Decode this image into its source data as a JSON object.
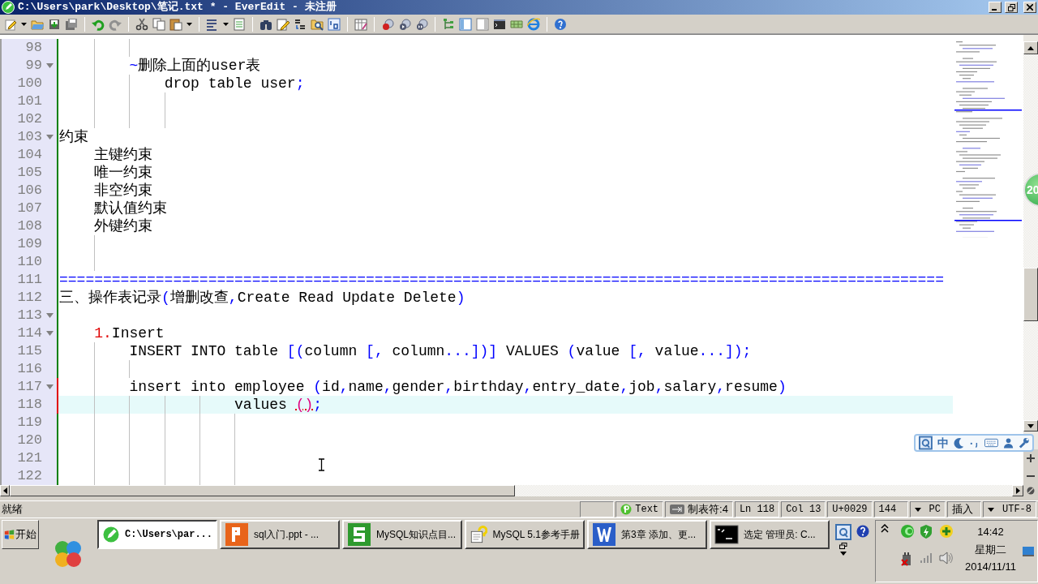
{
  "window": {
    "title": "C:\\Users\\park\\Desktop\\笔记.txt * - EverEdit - 未注册"
  },
  "editor": {
    "lines": [
      {
        "number": "98",
        "fold": false,
        "modified": false,
        "selected": false
      },
      {
        "number": "99",
        "fold": true,
        "modified": false,
        "selected": false,
        "segments": [
          {
            "kind": "symbol",
            "text": "        ~"
          },
          {
            "kind": "plain",
            "text": "删除上面的user表"
          }
        ]
      },
      {
        "number": "100",
        "fold": false,
        "modified": false,
        "selected": false,
        "segments": [
          {
            "kind": "plain",
            "text": "            drop table user"
          },
          {
            "kind": "symbol",
            "text": ";"
          }
        ]
      },
      {
        "number": "101",
        "fold": false,
        "modified": false,
        "selected": false
      },
      {
        "number": "102",
        "fold": false,
        "modified": false,
        "selected": false
      },
      {
        "number": "103",
        "fold": true,
        "modified": false,
        "selected": false,
        "segments": [
          {
            "kind": "plain",
            "text": "约束"
          }
        ]
      },
      {
        "number": "104",
        "fold": false,
        "modified": false,
        "selected": false,
        "segments": [
          {
            "kind": "plain",
            "text": "    主键约束"
          }
        ]
      },
      {
        "number": "105",
        "fold": false,
        "modified": false,
        "selected": false,
        "segments": [
          {
            "kind": "plain",
            "text": "    唯一约束"
          }
        ]
      },
      {
        "number": "106",
        "fold": false,
        "modified": false,
        "selected": false,
        "segments": [
          {
            "kind": "plain",
            "text": "    非空约束"
          }
        ]
      },
      {
        "number": "107",
        "fold": false,
        "modified": false,
        "selected": false,
        "segments": [
          {
            "kind": "plain",
            "text": "    默认值约束"
          }
        ]
      },
      {
        "number": "108",
        "fold": false,
        "modified": false,
        "selected": false,
        "segments": [
          {
            "kind": "plain",
            "text": "    外键约束"
          }
        ]
      },
      {
        "number": "109",
        "fold": false,
        "modified": false,
        "selected": false
      },
      {
        "number": "110",
        "fold": false,
        "modified": false,
        "selected": false
      },
      {
        "number": "111",
        "fold": false,
        "modified": false,
        "selected": false,
        "segments": [
          {
            "kind": "symbol",
            "text": "====================================================================================================="
          }
        ]
      },
      {
        "number": "112",
        "fold": false,
        "modified": false,
        "selected": false,
        "segments": [
          {
            "kind": "plain",
            "text": "三、操作表记录"
          },
          {
            "kind": "symbol",
            "text": "("
          },
          {
            "kind": "plain",
            "text": "增删改查"
          },
          {
            "kind": "symbol",
            "text": ","
          },
          {
            "kind": "plain",
            "text": "Create Read Update Delete"
          },
          {
            "kind": "symbol",
            "text": ")"
          }
        ]
      },
      {
        "number": "113",
        "fold": true,
        "modified": false,
        "selected": false
      },
      {
        "number": "114",
        "fold": true,
        "modified": false,
        "selected": false,
        "segments": [
          {
            "kind": "marker",
            "text": "    1."
          },
          {
            "kind": "plain",
            "text": "Insert"
          }
        ]
      },
      {
        "number": "115",
        "fold": false,
        "modified": false,
        "selected": false,
        "segments": [
          {
            "kind": "plain",
            "text": "        INSERT INTO table "
          },
          {
            "kind": "symbol",
            "text": "[("
          },
          {
            "kind": "plain",
            "text": "column "
          },
          {
            "kind": "symbol",
            "text": "[,"
          },
          {
            "kind": "plain",
            "text": " column"
          },
          {
            "kind": "symbol",
            "text": "...])]"
          },
          {
            "kind": "plain",
            "text": " VALUES "
          },
          {
            "kind": "symbol",
            "text": "("
          },
          {
            "kind": "plain",
            "text": "value "
          },
          {
            "kind": "symbol",
            "text": "[,"
          },
          {
            "kind": "plain",
            "text": " value"
          },
          {
            "kind": "symbol",
            "text": "...]);"
          }
        ]
      },
      {
        "number": "116",
        "fold": false,
        "modified": false,
        "selected": false
      },
      {
        "number": "117",
        "fold": true,
        "modified": true,
        "selected": false,
        "segments": [
          {
            "kind": "plain",
            "text": "        insert into employee "
          },
          {
            "kind": "symbol",
            "text": "("
          },
          {
            "kind": "plain",
            "text": "id"
          },
          {
            "kind": "symbol",
            "text": ","
          },
          {
            "kind": "plain",
            "text": "name"
          },
          {
            "kind": "symbol",
            "text": ","
          },
          {
            "kind": "plain",
            "text": "gender"
          },
          {
            "kind": "symbol",
            "text": ","
          },
          {
            "kind": "plain",
            "text": "birthday"
          },
          {
            "kind": "symbol",
            "text": ","
          },
          {
            "kind": "plain",
            "text": "entry_date"
          },
          {
            "kind": "symbol",
            "text": ","
          },
          {
            "kind": "plain",
            "text": "job"
          },
          {
            "kind": "symbol",
            "text": ","
          },
          {
            "kind": "plain",
            "text": "salary"
          },
          {
            "kind": "symbol",
            "text": ","
          },
          {
            "kind": "plain",
            "text": "resume"
          },
          {
            "kind": "symbol",
            "text": ")"
          }
        ]
      },
      {
        "number": "118",
        "fold": false,
        "modified": true,
        "selected": true,
        "segments": [
          {
            "kind": "plain",
            "text": "                    values "
          },
          {
            "kind": "match",
            "text": "()"
          },
          {
            "kind": "symbol",
            "text": ";"
          }
        ]
      },
      {
        "number": "119",
        "fold": false,
        "modified": false,
        "selected": false
      },
      {
        "number": "120",
        "fold": false,
        "modified": false,
        "selected": false
      },
      {
        "number": "121",
        "fold": false,
        "modified": false,
        "selected": false
      },
      {
        "number": "122",
        "fold": false,
        "modified": false,
        "selected": false
      }
    ]
  },
  "floating_badge": {
    "text": "20"
  },
  "ime_bar": {
    "mode": "中"
  },
  "status_bar": {
    "message": "就绪",
    "panels": [
      {
        "kind": "blank"
      },
      {
        "kind": "file-type",
        "text": "Text"
      },
      {
        "kind": "tab",
        "text": "制表符:4"
      },
      {
        "kind": "plain",
        "text": "Ln 118"
      },
      {
        "kind": "plain",
        "text": "Col 13"
      },
      {
        "kind": "plain",
        "text": "U+0029"
      },
      {
        "kind": "plain",
        "text": "144"
      },
      {
        "kind": "dropdown",
        "text": "PC"
      },
      {
        "kind": "plain",
        "text": "插入"
      },
      {
        "kind": "dropdown",
        "text": "UTF-8"
      }
    ]
  },
  "taskbar": {
    "start": "开始",
    "tasks": [
      {
        "kind": "editor",
        "label": "C:\\Users\\par...",
        "selected": true
      },
      {
        "kind": "slides",
        "label": "sql入门.ppt - ...",
        "selected": false
      },
      {
        "kind": "sheet",
        "label": "MySQL知识点目...",
        "selected": false
      },
      {
        "kind": "help",
        "label": "MySQL 5.1参考手册",
        "selected": false
      },
      {
        "kind": "writer",
        "label": "第3章 添加、更...",
        "selected": false
      },
      {
        "kind": "console",
        "label": "选定 管理员: C...",
        "selected": false
      }
    ],
    "clock": {
      "time": "14:42",
      "day": "星期二",
      "date": "2014/11/11"
    }
  }
}
